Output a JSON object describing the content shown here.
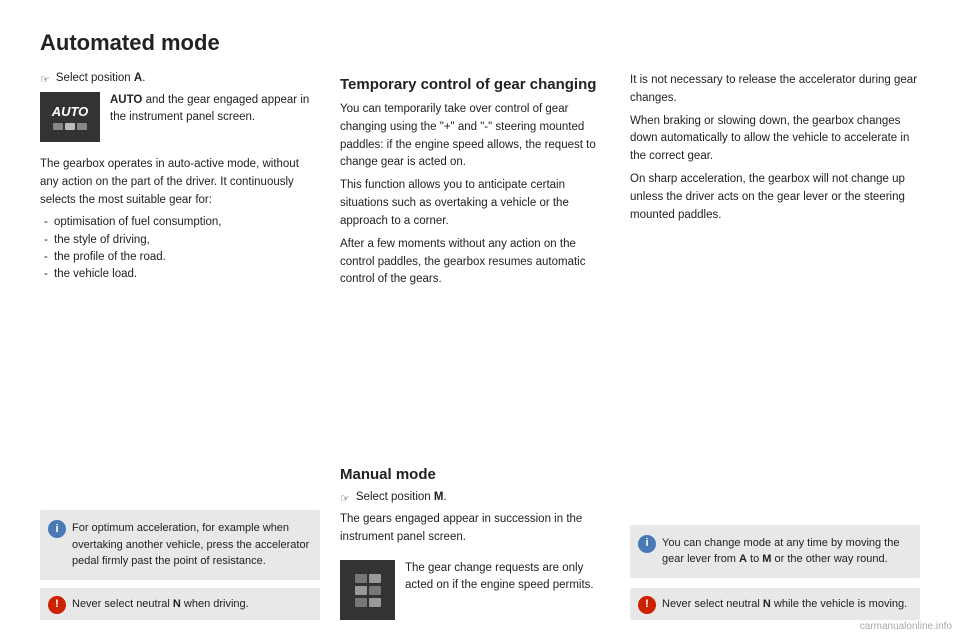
{
  "page": {
    "title": "Automated mode",
    "watermark": "carmanualonline.info"
  },
  "left_col": {
    "select_label": "Select position",
    "select_bold": "A",
    "select_suffix": ".",
    "auto_box": {
      "bold": "AUTO",
      "text": " and the gear engaged appear in the instrument panel screen."
    },
    "body_text": "The gearbox operates in auto-active mode, without any action on the part of the driver. It continuously selects the most suitable gear for:",
    "list_items": [
      "optimisation of fuel consumption,",
      "the style of driving,",
      "the profile of the road.",
      "the vehicle load."
    ],
    "info_box": {
      "text": "For optimum acceleration, for example when overtaking another vehicle, press the accelerator pedal firmly past the point of resistance."
    },
    "warning_box": {
      "pre": "Never select neutral ",
      "bold": "N",
      "post": " when driving."
    }
  },
  "mid_col": {
    "section_title": "Temporary control of gear changing",
    "paragraphs": [
      "You can temporarily take over control of gear changing using the \"+\" and \"-\" steering mounted paddles: if the engine speed allows, the request to change gear is acted on.",
      "This function allows you to anticipate certain situations such as overtaking a vehicle or the approach to a corner.",
      "After a few moments without any action on the control paddles, the gearbox resumes automatic control of the gears."
    ],
    "manual_title": "Manual mode",
    "manual_select": "Select position",
    "manual_bold": "M",
    "manual_select_suffix": ".",
    "manual_body": "The gears engaged appear in succession in the instrument panel screen.",
    "gear_box": {
      "text": "The gear change requests are only acted on if the engine speed permits."
    }
  },
  "right_col": {
    "paragraphs": [
      "It is not necessary to release the accelerator during gear changes.",
      "When braking or slowing down, the gearbox changes down automatically to allow the vehicle to accelerate in the correct gear.",
      "On sharp acceleration, the gearbox will not change up unless the driver acts on the gear lever or the steering mounted paddles."
    ],
    "info_box": {
      "pre": "You can change mode at any time by moving the gear lever from ",
      "bold1": "A",
      "mid": " to ",
      "bold2": "M",
      "post": " or the other way round."
    },
    "warning_box": {
      "pre": "Never select neutral ",
      "bold": "N",
      "mid": " while the vehicle is moving."
    }
  },
  "icons": {
    "info": "i",
    "warning": "!"
  }
}
